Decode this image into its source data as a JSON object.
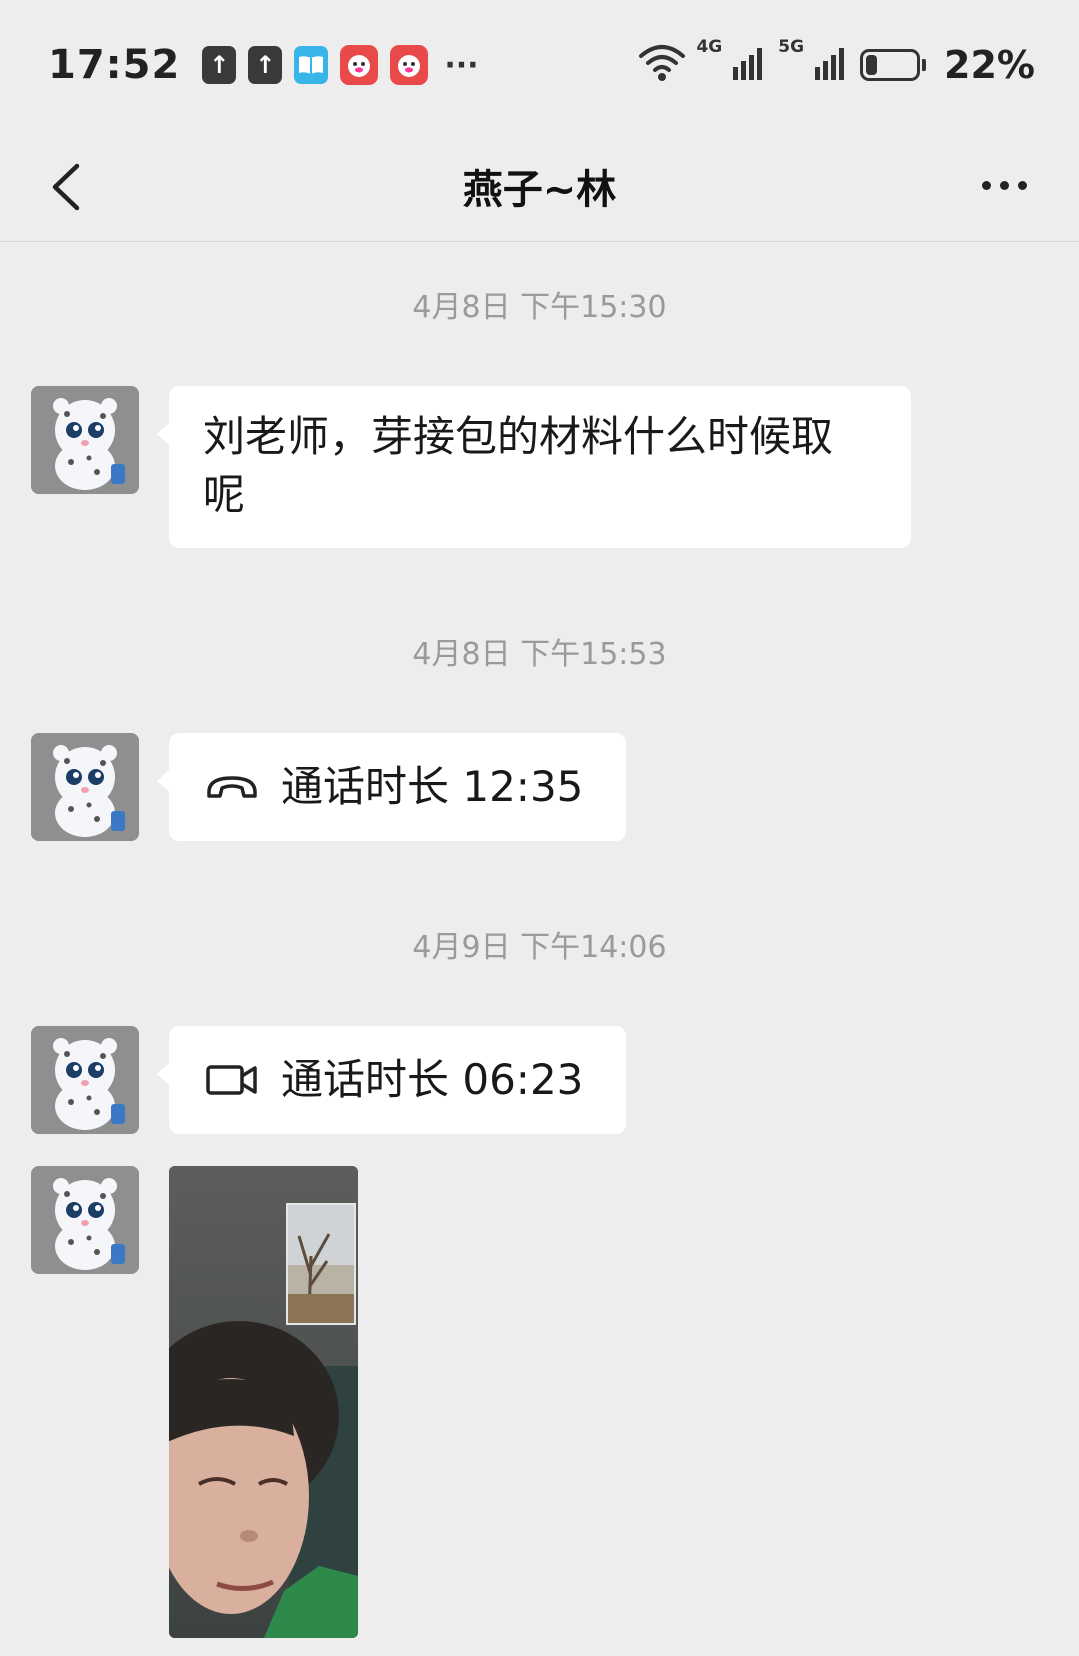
{
  "status_bar": {
    "time": "17:52",
    "notification_icons": [
      "upload-icon",
      "upload-icon",
      "book-app-icon",
      "618-app-icon",
      "618-app-icon"
    ],
    "more": "···",
    "network_4g": "4G",
    "network_5g": "5G",
    "battery_percent": "22%",
    "battery_level": 0.22
  },
  "nav": {
    "title": "燕子~林"
  },
  "messages": [
    {
      "timestamp": "4月8日 下午15:30",
      "text_line1": "刘老师，芽接包的材料什么时候取",
      "text_line2": "呢"
    },
    {
      "timestamp": "4月8日 下午15:53",
      "call_label": "通话时长 12:35",
      "call_type": "voice"
    },
    {
      "timestamp": "4月9日 下午14:06",
      "call_label": "通话时长 06:23",
      "call_type": "video"
    }
  ],
  "colors": {
    "background": "#ededed",
    "bubble": "#ffffff",
    "timestamp": "#9a9a9a"
  }
}
